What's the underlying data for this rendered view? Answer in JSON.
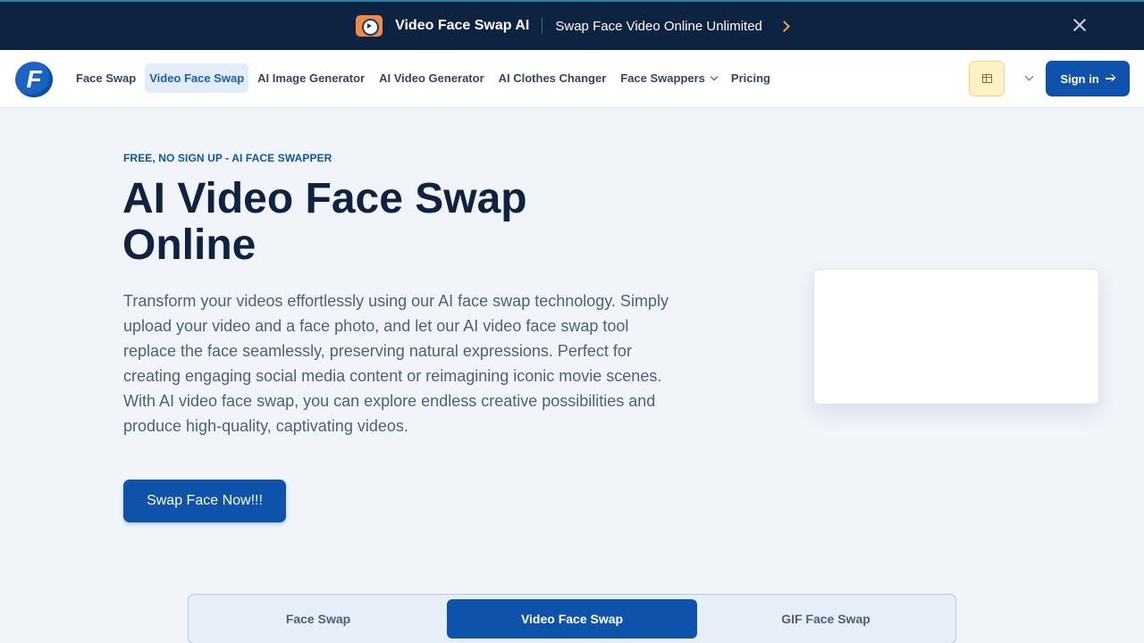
{
  "promo": {
    "title": "Video Face Swap AI",
    "subtitle": "Swap Face Video Online Unlimited",
    "icon": "video-app-icon",
    "close_icon": "close-icon"
  },
  "nav": {
    "logo_letter": "F",
    "items": [
      {
        "label": "Face Swap",
        "active": false
      },
      {
        "label": "Video Face Swap",
        "active": true
      },
      {
        "label": "AI Image Generator",
        "active": false
      },
      {
        "label": "AI Video Generator",
        "active": false
      },
      {
        "label": "AI Clothes Changer",
        "active": false
      },
      {
        "label": "Face Swappers",
        "active": false,
        "dropdown": true
      },
      {
        "label": "Pricing",
        "active": false
      }
    ],
    "gift_icon": "gift-icon",
    "signin_label": "Sign in"
  },
  "hero": {
    "eyebrow": "FREE, NO SIGN UP - AI FACE SWAPPER",
    "title": "AI Video Face Swap Online",
    "description": "Transform your videos effortlessly using our AI face swap technology. Simply upload your video and a face photo, and let our AI video face swap tool replace the face seamlessly, preserving natural expressions. Perfect for creating engaging social media content or reimagining iconic movie scenes. With AI video face swap, you can explore endless creative possibilities and produce high-quality, captivating videos.",
    "cta_label": "Swap Face Now!!!"
  },
  "tabs": [
    {
      "label": "Face Swap",
      "active": false
    },
    {
      "label": "Video Face Swap",
      "active": true
    },
    {
      "label": "GIF Face Swap",
      "active": false
    }
  ],
  "colors": {
    "brand": "#0e52ab",
    "banner_bg": "#0e2342",
    "page_bg": "#f1f5fa",
    "gift_bg": "#fdf2c4"
  }
}
